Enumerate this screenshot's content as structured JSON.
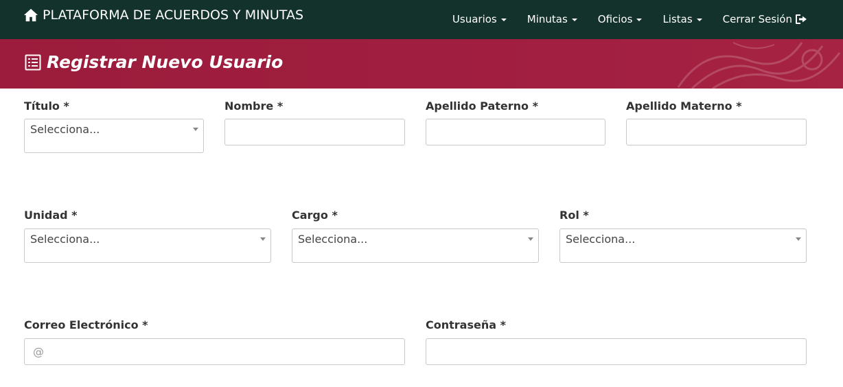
{
  "navbar": {
    "brand": "PLATAFORMA DE ACUERDOS Y MINUTAS",
    "items": [
      {
        "label": "Usuarios"
      },
      {
        "label": "Minutas"
      },
      {
        "label": "Oficios"
      },
      {
        "label": "Listas"
      }
    ],
    "logout": "Cerrar Sesión",
    "icons": {
      "brand": "home-icon",
      "logout": "sign-out-icon"
    }
  },
  "banner": {
    "title": "Registrar Nuevo Usuario",
    "icon": "list-icon"
  },
  "form": {
    "titulo": {
      "label": "Título",
      "required": "*",
      "value": "Selecciona..."
    },
    "nombre": {
      "label": "Nombre",
      "required": "*",
      "value": ""
    },
    "apellido_paterno": {
      "label": "Apellido Paterno",
      "required": "*",
      "value": ""
    },
    "apellido_materno": {
      "label": "Apellido Materno",
      "required": "*",
      "value": ""
    },
    "unidad": {
      "label": "Unidad",
      "required": "*",
      "value": "Selecciona..."
    },
    "cargo": {
      "label": "Cargo",
      "required": "*",
      "value": "Selecciona..."
    },
    "rol": {
      "label": "Rol",
      "required": "*",
      "value": "Selecciona..."
    },
    "correo": {
      "label": "Correo Electrónico",
      "required": "*",
      "placeholder": "@",
      "value": ""
    },
    "contrasena": {
      "label": "Contraseña",
      "required": "*",
      "value": ""
    }
  },
  "colors": {
    "navbar": "#13322b",
    "banner": "#9b1c3c",
    "text": "#333333"
  }
}
